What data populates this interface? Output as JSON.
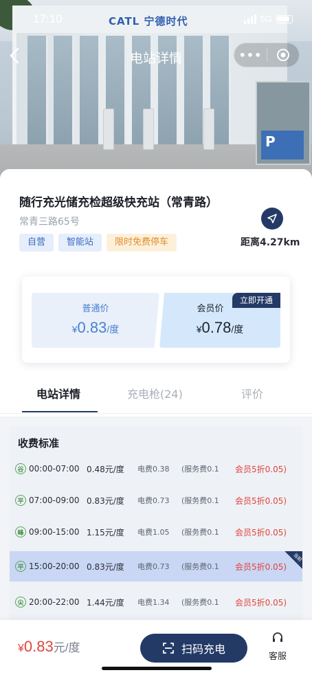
{
  "status_bar": {
    "time": "17:10",
    "network": "5G"
  },
  "nav": {
    "title": "电站详情",
    "more": "•••"
  },
  "hero": {
    "brand": "CATL 宁德时代"
  },
  "station": {
    "name": "随行充光储充检超级快充站（常青路）",
    "address": "常青三路65号",
    "tags": [
      "自营",
      "智能站",
      "限时免费停车"
    ],
    "distance": "距离4.27km"
  },
  "prices": {
    "normal_label": "普通价",
    "normal_currency": "¥",
    "normal_value": "0.83",
    "normal_unit": "/度",
    "member_label": "会员价",
    "member_currency": "¥",
    "member_value": "0.78",
    "member_unit": "/度",
    "open_label": "立即开通"
  },
  "tabs": [
    {
      "label": "电站详情",
      "active": true
    },
    {
      "label": "充电枪(24)",
      "active": false
    },
    {
      "label": "评价",
      "active": false
    }
  ],
  "fees": {
    "title": "收费标准",
    "rows": [
      {
        "badge": "谷",
        "time": "00:00-07:00",
        "price": "0.48元/度",
        "elec": "电费0.38",
        "service": "(服务费0.1",
        "member": "会员5折0.05)",
        "current": false
      },
      {
        "badge": "平",
        "time": "07:00-09:00",
        "price": "0.83元/度",
        "elec": "电费0.73",
        "service": "(服务费0.1",
        "member": "会员5折0.05)",
        "current": false
      },
      {
        "badge": "峰",
        "time": "09:00-15:00",
        "price": "1.15元/度",
        "elec": "电费1.05",
        "service": "(服务费0.1",
        "member": "会员5折0.05)",
        "current": false
      },
      {
        "badge": "平",
        "time": "15:00-20:00",
        "price": "0.83元/度",
        "elec": "电费0.73",
        "service": "(服务费0.1",
        "member": "会员5折0.05)",
        "current": true,
        "current_label": "当前"
      },
      {
        "badge": "尖",
        "time": "20:00-22:00",
        "price": "1.44元/度",
        "elec": "电费1.34",
        "service": "(服务费0.1",
        "member": "会员5折0.05)",
        "current": false
      }
    ]
  },
  "bottom": {
    "currency": "¥",
    "price": "0.83",
    "unit": "元/度",
    "scan_label": "扫码充电",
    "service_label": "客服"
  },
  "colors": {
    "primary": "#243a66",
    "accent_red": "#e0463c",
    "tag_orange": "#e08e2b",
    "tag_blue": "#3d6bc2"
  }
}
